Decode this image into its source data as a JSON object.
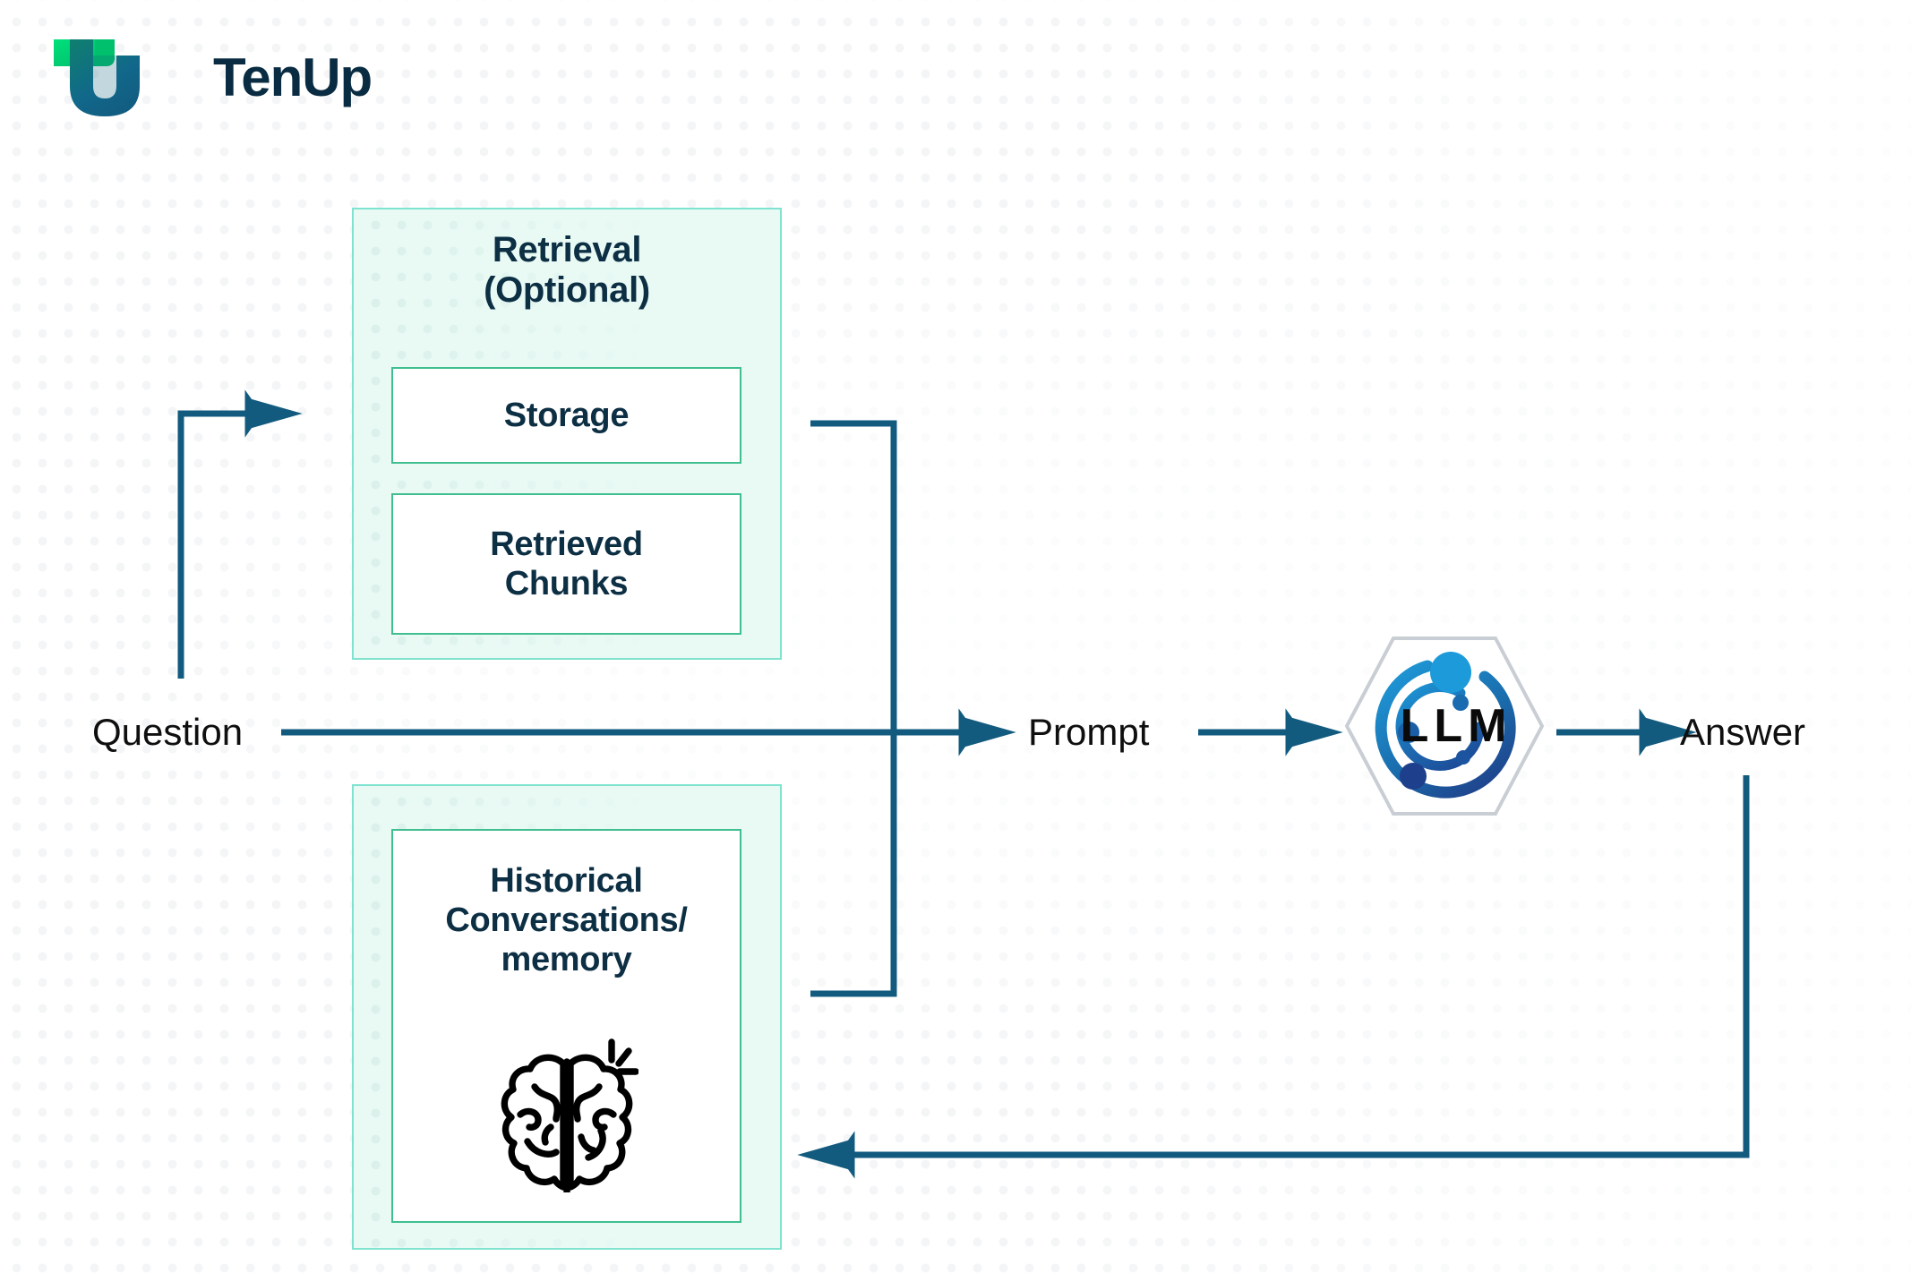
{
  "brand": {
    "logo_text": "TenUp",
    "logo_icon": "tenup-t-u-mark",
    "colors": {
      "logo_green": "#00d26a",
      "logo_teal": "#0d7a6e",
      "logo_blue": "#125b80",
      "logo_navy": "#0a2c42"
    }
  },
  "diagram": {
    "title": "RAG / LLM prompt flow",
    "colors": {
      "arrow": "#125b7f",
      "panel_fill": "#e9faf5",
      "panel_border": "#7fe3d0",
      "inner_border": "#3fbf8f",
      "heading_text": "#0d2f44",
      "label_text": "#0f0f0f"
    },
    "panels": [
      {
        "id": "retrieval",
        "title_line1": "Retrieval",
        "title_line2": "(Optional)",
        "boxes": [
          {
            "id": "storage",
            "label": "Storage"
          },
          {
            "id": "retrieved-chunks",
            "label_line1": "Retrieved",
            "label_line2": "Chunks"
          }
        ]
      },
      {
        "id": "memory",
        "title": "",
        "boxes": [
          {
            "id": "memory",
            "label_line1": "Historical",
            "label_line2": "Conversations/",
            "label_line3": "memory",
            "icon": "brain-icon"
          }
        ]
      }
    ],
    "flow_labels": [
      {
        "id": "question",
        "text": "Question"
      },
      {
        "id": "prompt",
        "text": "Prompt"
      },
      {
        "id": "answer",
        "text": "Answer"
      }
    ],
    "llm_node": {
      "label": "LLM",
      "shape": "hexagon",
      "icon": "llm-orbit-icon",
      "colors": {
        "light": "#1c94d2",
        "mid": "#1a6fae",
        "dark": "#1f3f86"
      }
    },
    "connections": [
      {
        "from": "answer",
        "to": "retrieval",
        "type": "feedback-up-left"
      },
      {
        "from": "question",
        "to": "prompt",
        "type": "straight-right"
      },
      {
        "from": "storage",
        "to": "prompt",
        "type": "elbow-right"
      },
      {
        "from": "memory",
        "to": "prompt",
        "type": "elbow-right"
      },
      {
        "from": "prompt",
        "to": "llm",
        "type": "straight-right"
      },
      {
        "from": "llm",
        "to": "answer",
        "type": "straight-right"
      },
      {
        "from": "answer",
        "to": "memory",
        "type": "feedback-down-left"
      }
    ]
  }
}
